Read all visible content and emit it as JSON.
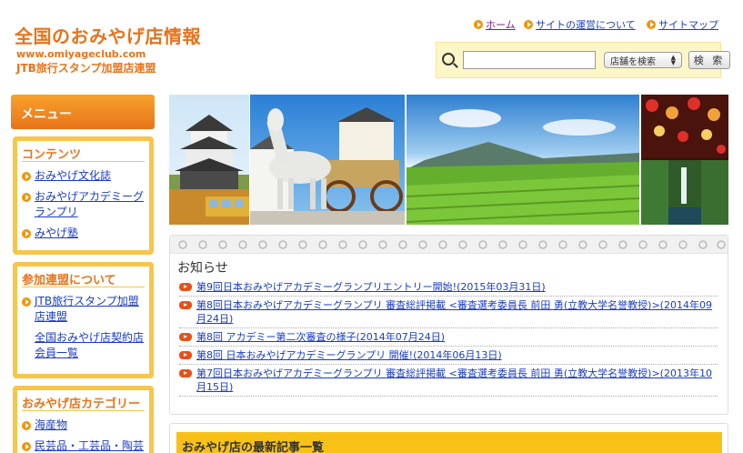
{
  "header": {
    "title": "全国のおみやげ店情報",
    "url": "www.omiyageclub.com",
    "subtitle": "JTB旅行スタンプ加盟店連盟"
  },
  "top_nav": [
    {
      "label": "ホーム"
    },
    {
      "label": "サイトの運営について"
    },
    {
      "label": "サイトマップ"
    }
  ],
  "search": {
    "value": "",
    "select_value": "店舗を検索",
    "button_label": "検 索"
  },
  "sidebar": {
    "menu_title": "メニュー",
    "sections": [
      {
        "title": "コンテンツ",
        "items": [
          {
            "label": "おみやげ文化誌"
          },
          {
            "label": "おみやげアカデミーグランプリ"
          },
          {
            "label": "みやげ塾"
          }
        ]
      },
      {
        "title": "参加連盟について",
        "items": [
          {
            "label": "JTB旅行スタンプ加盟店連盟"
          },
          {
            "label": "全国おみやげ店契約店会員一覧"
          }
        ]
      },
      {
        "title": "おみやげ店カテゴリー",
        "items": [
          {
            "label": "海産物"
          },
          {
            "label": "民芸品・工芸品・陶芸"
          }
        ]
      }
    ]
  },
  "notices": {
    "title": "お知らせ",
    "items": [
      {
        "text": "第9回日本おみやげアカデミーグランプリエントリー開始!(2015年03月31日)"
      },
      {
        "text": "第8回日本おみやげアカデミーグランプリ 審査総評掲載 <審査選考委員長 前田 勇(立教大学名誉教授)>(2014年09月24日)"
      },
      {
        "text": "第8回 アカデミー第二次審査の様子(2014年07月24日)"
      },
      {
        "text": "第8回 日本おみやげアカデミーグランプリ 開催!(2014年06月13日)"
      },
      {
        "text": "第7回日本おみやげアカデミーグランプリ 審査総評掲載 <審査選考委員長 前田 勇(立教大学名誉教授)>(2013年10月15日)"
      }
    ]
  },
  "latest": {
    "title": "おみやげ店の最新記事一覧"
  },
  "colors": {
    "brand_orange": "#e8731a",
    "sidebar_border": "#f8c54a",
    "search_bg": "#fff6c8",
    "latest_header": "#f8c118",
    "link_blue": "#1a3cc7"
  }
}
